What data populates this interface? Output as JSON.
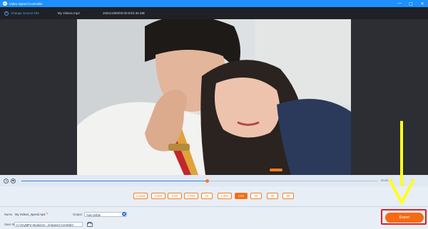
{
  "app": {
    "title": "Video Speed Controller"
  },
  "window_controls": {
    "minimize": "—",
    "maximize": "▢",
    "close": "✕"
  },
  "source": {
    "change_label": "Change Source File",
    "file_name": "My Videos.mp4",
    "file_info": "1920x1080/00:00:03/3.36 MB"
  },
  "player": {
    "timecode": "00:00:03"
  },
  "playback": {
    "progress": 0.52
  },
  "speeds": {
    "options": [
      "0.125X",
      "0.25X",
      "0.5X",
      "0.75X",
      "1X",
      "1.25X",
      "1.5X",
      "2X",
      "4X",
      "8X"
    ],
    "selected": "1.5X"
  },
  "output": {
    "name_label": "Name:",
    "name_value": "My Videos_speed.mp4",
    "output_label": "Output:",
    "output_value": "Auto;24fps",
    "save_label": "Save to:",
    "save_value": "C:\\AnyMP4 Studio\\An...\\e\\Speed Controller",
    "export_label": "Export"
  },
  "colors": {
    "accent": "#f56a12",
    "title_bar": "#1e90ff",
    "highlight_frame": "#e31e24",
    "annotation_arrow": "#ffff1a"
  }
}
